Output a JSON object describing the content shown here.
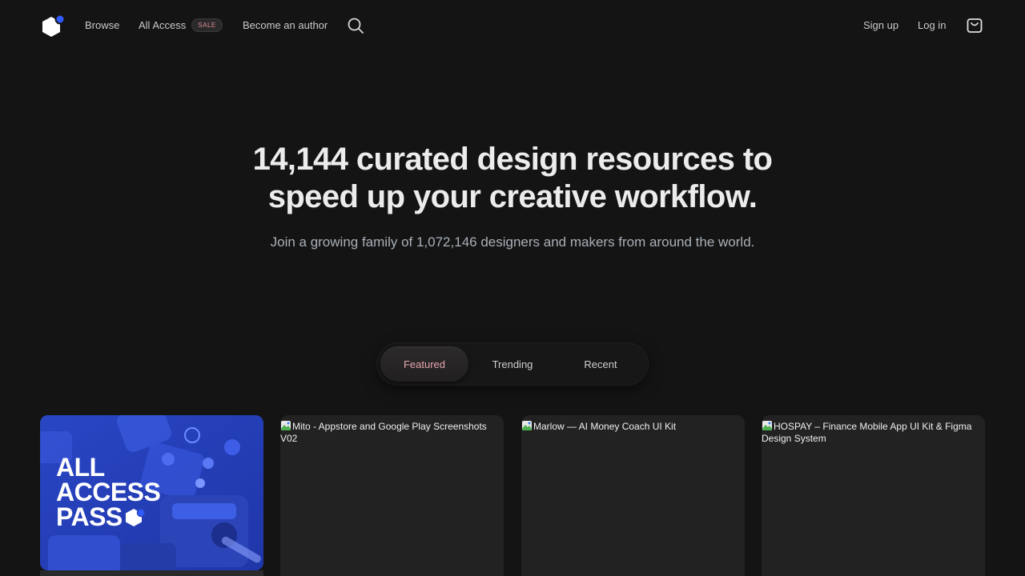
{
  "nav": {
    "browse": "Browse",
    "all_access": "All Access",
    "sale_badge": "SALE",
    "become_author": "Become an author",
    "sign_up": "Sign up",
    "log_in": "Log in"
  },
  "hero": {
    "title_line1": "14,144 curated design resources to",
    "title_line2": "speed up your creative workflow.",
    "subtitle": "Join a growing family of 1,072,146 designers and makers from around the world."
  },
  "tabs": [
    {
      "label": "Featured",
      "active": true
    },
    {
      "label": "Trending",
      "active": false
    },
    {
      "label": "Recent",
      "active": false
    }
  ],
  "promo": {
    "line1": "ALL",
    "line2": "ACCESS",
    "line3": "PASS"
  },
  "cards": [
    {
      "alt": "Mito - Appstore and Google Play Screenshots V02"
    },
    {
      "alt": "Marlow — AI Money Coach UI Kit"
    },
    {
      "alt": "HOSPAY – Finance Mobile App UI Kit & Figma Design System"
    }
  ],
  "colors": {
    "background": "#141414",
    "accent_blue": "#2f5bff",
    "tab_active_text": "#e6a6b0",
    "promo_blue": "#2a47c7"
  }
}
